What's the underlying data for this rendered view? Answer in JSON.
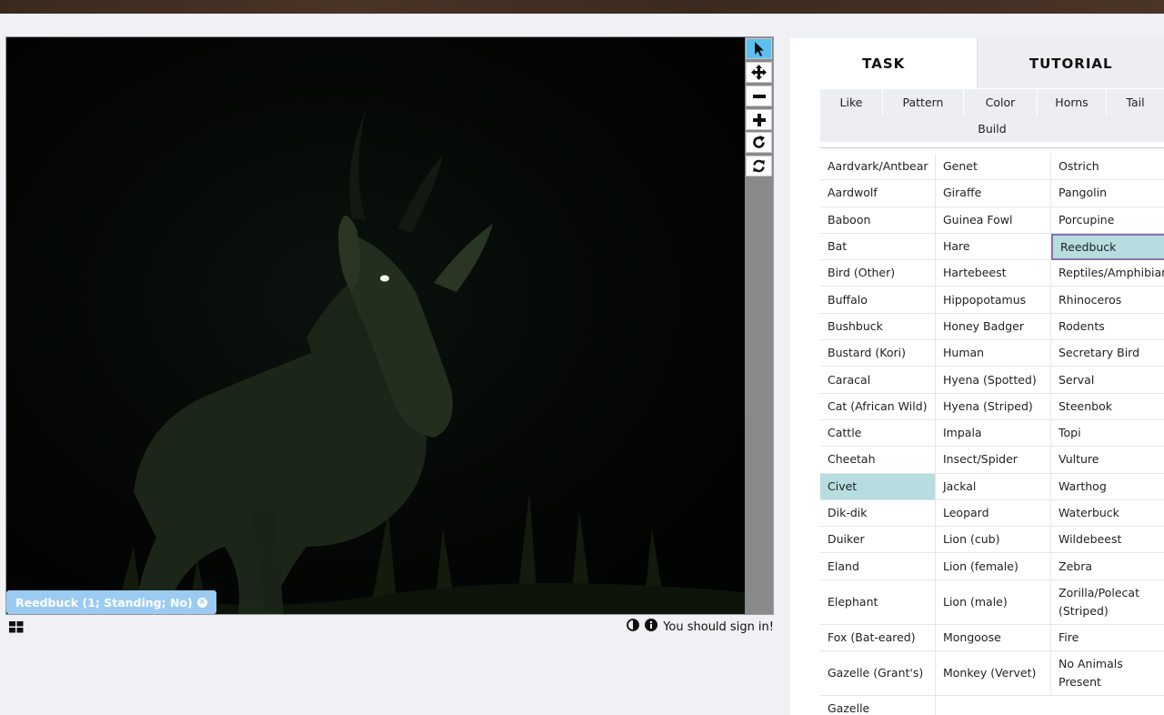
{
  "viewer": {
    "tools": [
      {
        "name": "select-pointer-icon",
        "active": true
      },
      {
        "name": "pan-move-icon",
        "active": false
      },
      {
        "name": "zoom-out-icon",
        "active": false
      },
      {
        "name": "zoom-in-icon",
        "active": false
      },
      {
        "name": "rotate-icon",
        "active": false
      },
      {
        "name": "reset-refresh-icon",
        "active": false
      }
    ],
    "mark_label": "Reedbuck (1; Standing; No)",
    "mark_remove_glyph": "×",
    "status_text": "You should sign in!",
    "icons": [
      "grid-icon",
      "contrast-icon",
      "info-icon"
    ]
  },
  "panel": {
    "tabs": {
      "task": "TASK",
      "tutorial": "TUTORIAL"
    },
    "filters": {
      "row1": [
        "Like",
        "Pattern",
        "Color",
        "Horns",
        "Tail"
      ],
      "row2": "Build"
    },
    "species": {
      "col1": [
        "Aardvark/Antbear",
        "Aardwolf",
        "Baboon",
        "Bat",
        "Bird (Other)",
        "Buffalo",
        "Bushbuck",
        "Bustard (Kori)",
        "Caracal",
        "Cat (African Wild)",
        "Cattle",
        "Cheetah",
        "Civet",
        "Dik-dik",
        "Duiker",
        "Eland",
        "Elephant",
        "Fox (Bat-eared)",
        "Gazelle (Grant's)",
        "Gazelle"
      ],
      "col2": [
        "Genet",
        "Giraffe",
        "Guinea Fowl",
        "Hare",
        "Hartebeest",
        "Hippopotamus",
        "Honey Badger",
        "Human",
        "Hyena (Spotted)",
        "Hyena (Striped)",
        "Impala",
        "Insect/Spider",
        "Jackal",
        "Leopard",
        "Lion (cub)",
        "Lion (female)",
        "Lion (male)",
        "Mongoose",
        "Monkey (Vervet)"
      ],
      "col3": [
        "Ostrich",
        "Pangolin",
        "Porcupine",
        "Reedbuck",
        "Reptiles/Amphibians",
        "Rhinoceros",
        "Rodents",
        "Secretary Bird",
        "Serval",
        "Steenbok",
        "Topi",
        "Vulture",
        "Warthog",
        "Waterbuck",
        "Wildebeest",
        "Zebra",
        "Zorilla/Polecat (Striped)",
        "Fire",
        "No Animals Present"
      ]
    },
    "selected": {
      "civet": "Civet",
      "reedbuck": "Reedbuck"
    },
    "colors": {
      "highlight": "#b6dde0",
      "selected_outline": "#8a72a8",
      "active_tool": "#5bc0f0",
      "mark_badge": "#9ccbf2"
    }
  }
}
